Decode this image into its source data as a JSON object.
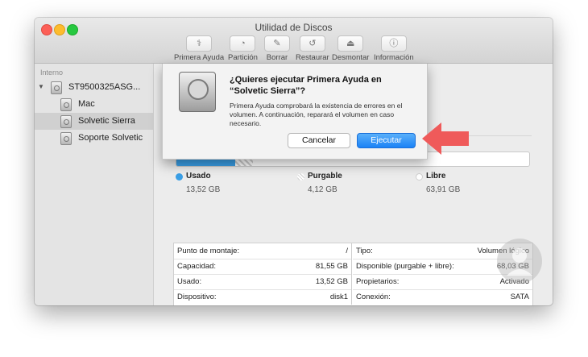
{
  "window": {
    "title": "Utilidad de Discos"
  },
  "toolbar": {
    "items": [
      {
        "label": "Primera Ayuda",
        "icon": "stethoscope-icon",
        "glyph": "⚕"
      },
      {
        "label": "Partición",
        "icon": "partition-icon",
        "glyph": "◔"
      },
      {
        "label": "Borrar",
        "icon": "erase-icon",
        "glyph": "✎"
      },
      {
        "label": "Restaurar",
        "icon": "restore-icon",
        "glyph": "↺"
      },
      {
        "label": "Desmontar",
        "icon": "eject-icon",
        "glyph": "⏏"
      },
      {
        "label": "Información",
        "icon": "info-icon",
        "glyph": "ⓘ"
      }
    ]
  },
  "sidebar": {
    "section": "Interno",
    "disk": {
      "label": "ST9500325ASG..."
    },
    "volumes": [
      {
        "label": "Mac",
        "selected": false
      },
      {
        "label": "Solvetic Sierra",
        "selected": true
      },
      {
        "label": "Soporte Solvetic",
        "selected": false
      }
    ]
  },
  "usage": {
    "used_fraction": 0.1658,
    "purgeable_fraction": 0.0505,
    "colors": {
      "used": "#3a9fe6",
      "purgeable": "#cfcfcf",
      "free": "#ffffff"
    },
    "legend": [
      {
        "title": "Usado",
        "value": "13,52 GB",
        "color": "#3a9fe6"
      },
      {
        "title": "Purgable",
        "value": "4,12 GB",
        "color": "#d9d9d9"
      },
      {
        "title": "Libre",
        "value": "63,91 GB",
        "color": "#ffffff"
      }
    ]
  },
  "info": {
    "left": [
      {
        "key": "Punto de montaje:",
        "value": "/"
      },
      {
        "key": "Capacidad:",
        "value": "81,55 GB"
      },
      {
        "key": "Usado:",
        "value": "13,52 GB"
      },
      {
        "key": "Dispositivo:",
        "value": "disk1"
      }
    ],
    "right": [
      {
        "key": "Tipo:",
        "value": "Volumen lógico"
      },
      {
        "key": "Disponible (purgable + libre):",
        "value": "68,03 GB"
      },
      {
        "key": "Propietarios:",
        "value": "Activado"
      },
      {
        "key": "Conexión:",
        "value": "SATA"
      }
    ]
  },
  "dialog": {
    "title": "¿Quieres ejecutar Primera Ayuda en “Solvetic Sierra”?",
    "body": "Primera Ayuda comprobará la existencia de errores en el volumen. A continuación, reparará el volumen en caso necesario.",
    "cancel_label": "Cancelar",
    "run_label": "Ejecutar"
  },
  "accent_colors": {
    "arrow": "#ef5a5a",
    "primary_button": "#1a82f6"
  }
}
